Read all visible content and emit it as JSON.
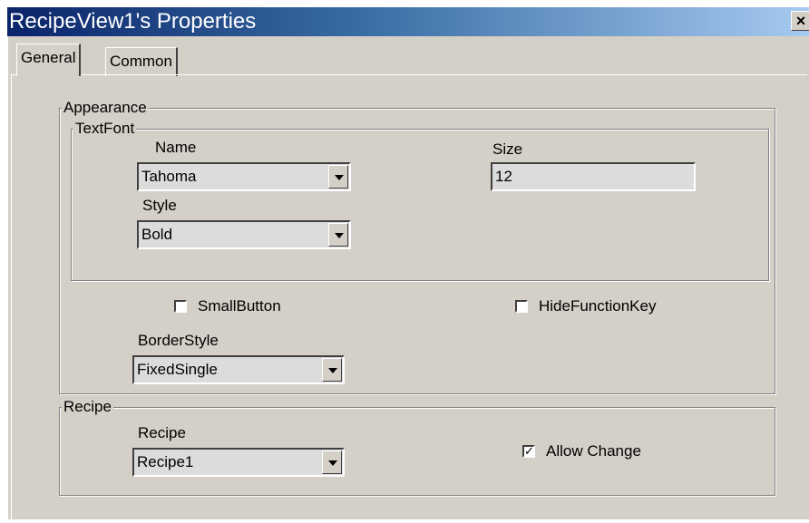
{
  "window": {
    "title": "RecipeView1's Properties",
    "close_glyph": "×"
  },
  "tabs": [
    {
      "label": "General",
      "active": true
    },
    {
      "label": "Common",
      "active": false
    }
  ],
  "appearance": {
    "legend": "Appearance",
    "textfont": {
      "legend": "TextFont",
      "name_label": "Name",
      "name_value": "Tahoma",
      "size_label": "Size",
      "size_value": "12",
      "style_label": "Style",
      "style_value": "Bold"
    },
    "small_button": {
      "label": "SmallButton",
      "checked": false
    },
    "hide_function_key": {
      "label": "HideFunctionKey",
      "checked": false
    },
    "border_style_label": "BorderStyle",
    "border_style_value": "FixedSingle"
  },
  "recipe": {
    "legend": "Recipe",
    "recipe_label": "Recipe",
    "recipe_value": "Recipe1",
    "allow_change": {
      "label": "Allow Change",
      "checked": true,
      "check_glyph": "✓"
    }
  }
}
